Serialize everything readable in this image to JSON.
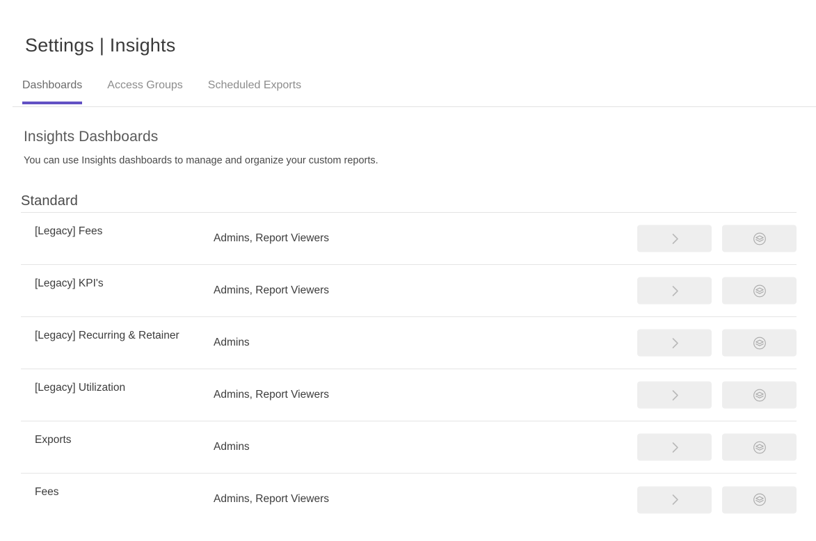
{
  "theme": {
    "accent": "#6251c4",
    "button_bg": "#eeeeee",
    "divider": "#e4e4e4",
    "text": "#3c3c3c",
    "muted_text": "#8c8c8c"
  },
  "header": {
    "title": "Settings | Insights"
  },
  "tabs": [
    {
      "label": "Dashboards",
      "active": true
    },
    {
      "label": "Access Groups",
      "active": false
    },
    {
      "label": "Scheduled Exports",
      "active": false
    }
  ],
  "intro": {
    "title": "Insights Dashboards",
    "description": "You can use Insights dashboards to manage and organize your custom reports."
  },
  "groups": [
    {
      "heading": "Standard",
      "rows": [
        {
          "name": "[Legacy] Fees",
          "access_groups": "Admins, Report Viewers",
          "actions": [
            {
              "icon": "chevron-right-icon",
              "name": "open-dashboard-button"
            },
            {
              "icon": "layers-circle-icon",
              "name": "duplicate-dashboard-button"
            }
          ]
        },
        {
          "name": "[Legacy] KPI's",
          "access_groups": "Admins, Report Viewers",
          "actions": [
            {
              "icon": "chevron-right-icon",
              "name": "open-dashboard-button"
            },
            {
              "icon": "layers-circle-icon",
              "name": "duplicate-dashboard-button"
            }
          ]
        },
        {
          "name": "[Legacy] Recurring & Retainer",
          "access_groups": "Admins",
          "actions": [
            {
              "icon": "chevron-right-icon",
              "name": "open-dashboard-button"
            },
            {
              "icon": "layers-circle-icon",
              "name": "duplicate-dashboard-button"
            }
          ]
        },
        {
          "name": "[Legacy] Utilization",
          "access_groups": "Admins, Report Viewers",
          "actions": [
            {
              "icon": "chevron-right-icon",
              "name": "open-dashboard-button"
            },
            {
              "icon": "layers-circle-icon",
              "name": "duplicate-dashboard-button"
            }
          ]
        },
        {
          "name": "Exports",
          "access_groups": "Admins",
          "actions": [
            {
              "icon": "chevron-right-icon",
              "name": "open-dashboard-button"
            },
            {
              "icon": "layers-circle-icon",
              "name": "duplicate-dashboard-button"
            }
          ]
        },
        {
          "name": "Fees",
          "access_groups": "Admins, Report Viewers",
          "actions": [
            {
              "icon": "chevron-right-icon",
              "name": "open-dashboard-button"
            },
            {
              "icon": "layers-circle-icon",
              "name": "duplicate-dashboard-button"
            }
          ]
        }
      ]
    }
  ]
}
